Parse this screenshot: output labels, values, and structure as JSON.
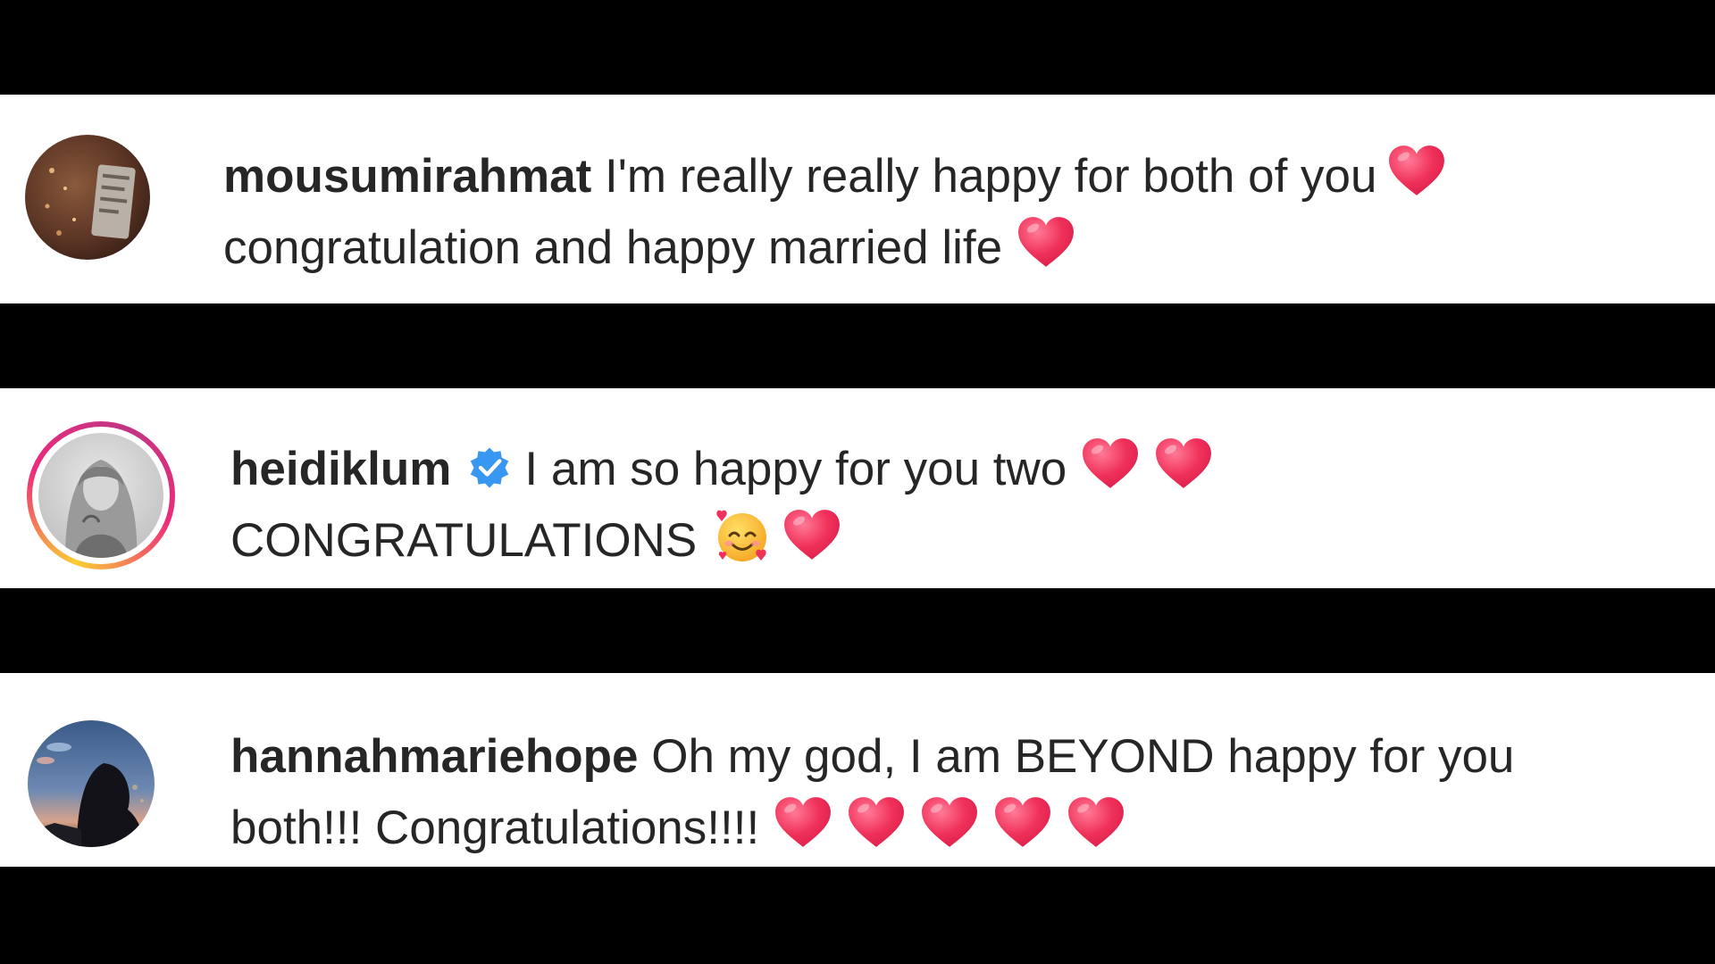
{
  "colors": {
    "background": "#000000",
    "card": "#ffffff",
    "text": "#262626",
    "heart": "#f0325a",
    "verified_badge": "#3897f0",
    "story_ring_start": "#f9ce34",
    "story_ring_end": "#c13584"
  },
  "comments": [
    {
      "username": "mousumirahmat",
      "verified": false,
      "line1": "I'm really really happy for both of you",
      "line2": "congratulation and happy married life",
      "emojis": [
        "red-heart-icon",
        "red-heart-icon"
      ]
    },
    {
      "username": "heidiklum",
      "verified": true,
      "line1": "I am so happy for you two",
      "line2": "CONGRATULATIONS",
      "emojis": [
        "red-heart-icon",
        "red-heart-icon",
        "smiling-face-with-hearts-icon",
        "red-heart-icon"
      ]
    },
    {
      "username": "hannahmariehope",
      "verified": false,
      "line1": "Oh my god, I am BEYOND happy for you",
      "line2": "both!!! Congratulations!!!!",
      "emojis": [
        "red-heart-icon",
        "red-heart-icon",
        "red-heart-icon",
        "red-heart-icon",
        "red-heart-icon"
      ]
    }
  ]
}
